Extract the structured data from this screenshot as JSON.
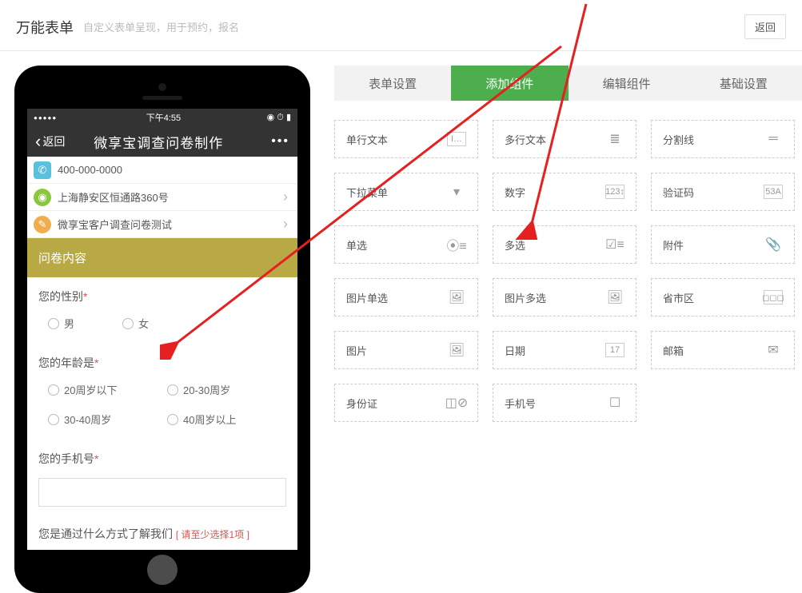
{
  "header": {
    "title": "万能表单",
    "subtitle": "自定义表单呈现，用于预约，报名",
    "back": "返回"
  },
  "phone": {
    "status_time": "下午4:55",
    "status_right": "◉ ⏱ ▮",
    "nav_back": "返回",
    "nav_title": "微享宝调查问卷制作",
    "nav_dots": "•••",
    "rows": [
      {
        "text": "400-000-0000",
        "icon": "phone",
        "color": "blue"
      },
      {
        "text": "上海静安区恒通路360号",
        "icon": "pin",
        "color": "green",
        "chevron": true
      },
      {
        "text": "微享宝客户调查问卷测试",
        "icon": "pencil",
        "color": "orange",
        "chevron": true
      }
    ],
    "section_header": "问卷内容",
    "q1": {
      "label": "您的性别",
      "opts": [
        "男",
        "女"
      ]
    },
    "q2": {
      "label": "您的年龄是",
      "opts": [
        "20周岁以下",
        "20-30周岁",
        "30-40周岁",
        "40周岁以上"
      ]
    },
    "q3": {
      "label": "您的手机号"
    },
    "q4": {
      "label": "您是通过什么方式了解我们",
      "warn": "[ 请至少选择1项 ]"
    }
  },
  "tabs": [
    "表单设置",
    "添加组件",
    "编辑组件",
    "基础设置"
  ],
  "active_tab": 1,
  "components": [
    {
      "label": "单行文本",
      "icon": "text-single"
    },
    {
      "label": "多行文本",
      "icon": "text-multi"
    },
    {
      "label": "分割线",
      "icon": "divider"
    },
    {
      "label": "下拉菜单",
      "icon": "dropdown"
    },
    {
      "label": "数字",
      "icon": "number"
    },
    {
      "label": "验证码",
      "icon": "captcha"
    },
    {
      "label": "单选",
      "icon": "radio"
    },
    {
      "label": "多选",
      "icon": "checkbox"
    },
    {
      "label": "附件",
      "icon": "attach"
    },
    {
      "label": "图片单选",
      "icon": "img-radio"
    },
    {
      "label": "图片多选",
      "icon": "img-check"
    },
    {
      "label": "省市区",
      "icon": "region"
    },
    {
      "label": "图片",
      "icon": "image"
    },
    {
      "label": "日期",
      "icon": "date"
    },
    {
      "label": "邮箱",
      "icon": "email"
    },
    {
      "label": "身份证",
      "icon": "idcard"
    },
    {
      "label": "手机号",
      "icon": "mobile"
    }
  ],
  "icons": {
    "text-single": "I…",
    "text-multi": "≣",
    "divider": "═",
    "dropdown": "▾",
    "number": "123↕",
    "captcha": "53A",
    "radio": "⦿≡",
    "checkbox": "☑≡",
    "attach": "📎",
    "img-radio": "🖼",
    "img-check": "🖼",
    "region": "◻◻◻",
    "image": "🖼",
    "date": "17",
    "email": "✉",
    "idcard": "◫⊘",
    "mobile": "☐"
  }
}
